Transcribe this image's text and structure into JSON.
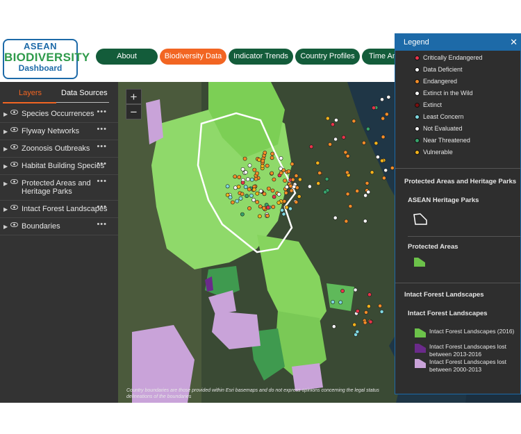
{
  "logo": {
    "line1": "ASEAN",
    "line2": "BIODIVERSITY",
    "line3": "Dashboard"
  },
  "nav": [
    {
      "label": "About",
      "active": false
    },
    {
      "label": "Biodiversity Data",
      "active": true
    },
    {
      "label": "Indicator Trends",
      "active": false
    },
    {
      "label": "Country Profiles",
      "active": false
    },
    {
      "label": "Time An",
      "active": false
    }
  ],
  "sidebar": {
    "tabs": {
      "layers": "Layers",
      "sources": "Data Sources"
    },
    "layers": [
      "Species Occurrences",
      "Flyway Networks",
      "Zoonosis Outbreaks",
      "Habitat Building Species",
      "Protected Areas and Heritage Parks",
      "Intact Forest Landscapes",
      "Boundaries"
    ],
    "more_icon": "•••"
  },
  "map": {
    "zoom_in": "+",
    "zoom_out": "−",
    "credit": "Country boundaries are those provided within Esri basemaps and do not express opinions concerning the legal status delineations of the boundaries"
  },
  "legend": {
    "title": "Legend",
    "close": "✕",
    "status_items": [
      {
        "label": "Critically Endangered",
        "color": "#e8344a"
      },
      {
        "label": "Data Deficient",
        "color": "#ffffff"
      },
      {
        "label": "Endangered",
        "color": "#f28c28"
      },
      {
        "label": "Extinct in the Wild",
        "color": "#ffffff"
      },
      {
        "label": "Extinct",
        "color": "#7a0f0f"
      },
      {
        "label": "Least Concern",
        "color": "#7fd8e0"
      },
      {
        "label": "Not Evaluated",
        "color": "#f2f2f2"
      },
      {
        "label": "Near Threatened",
        "color": "#37a36b"
      },
      {
        "label": "Vulnerable",
        "color": "#f2b21b"
      }
    ],
    "protected_title": "Protected Areas and Heritage Parks",
    "heritage_sub": "ASEAN Heritage Parks",
    "protected_sub": "Protected Areas",
    "forest_title": "Intact Forest Landscapes",
    "forest_sub": "Intact Forest Landscapes",
    "forest_items": [
      {
        "label": "Intact Forest Landscapes (2016)",
        "color": "#6cc24a"
      },
      {
        "label": "Intact Forest Landscapes lost between 2013-2016",
        "color": "#6a2a8a"
      },
      {
        "label": "Intact Forest Landscapes lost between 2000-2013",
        "color": "#c9a3d9"
      }
    ]
  }
}
